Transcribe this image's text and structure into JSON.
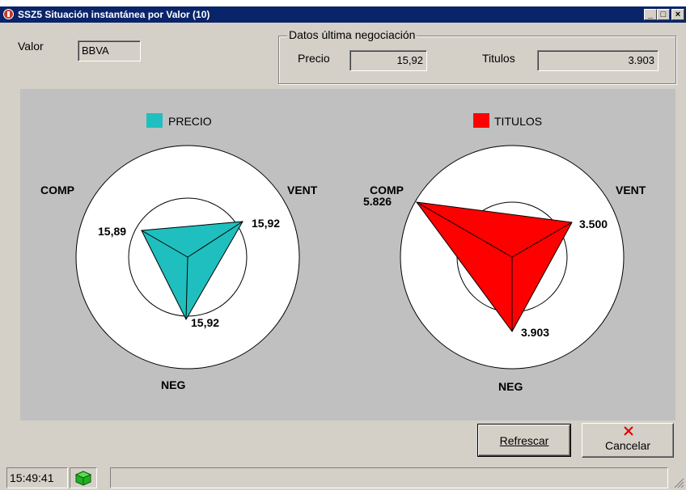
{
  "window": {
    "title": "SSZ5 Situación instantánea por Valor (10)",
    "controls": {
      "minimize": "_",
      "maximize": "□",
      "close": "×"
    }
  },
  "valor": {
    "label": "Valor",
    "value": "BBVA"
  },
  "ultima_negociacion": {
    "title": "Datos última negociación",
    "precio_label": "Precio",
    "precio_value": "15,92",
    "titulos_label": "Titulos",
    "titulos_value": "3.903"
  },
  "charts": [
    {
      "legend": "PRECIO",
      "color": "#1fbfbf",
      "axes": {
        "comp": "COMP",
        "vent": "VENT",
        "neg": "NEG"
      },
      "values": {
        "comp": "15,89",
        "vent": "15,92",
        "neg": "15,92"
      }
    },
    {
      "legend": "TITULOS",
      "color": "#ff0000",
      "axes": {
        "comp": "COMP",
        "vent": "VENT",
        "neg": "NEG"
      },
      "values": {
        "comp": "5.826",
        "vent": "3.500",
        "neg": "3.903"
      }
    }
  ],
  "buttons": {
    "refrescar": "Refrescar",
    "cancelar": "Cancelar"
  },
  "status": {
    "time": "15:49:41",
    "message": ""
  }
}
